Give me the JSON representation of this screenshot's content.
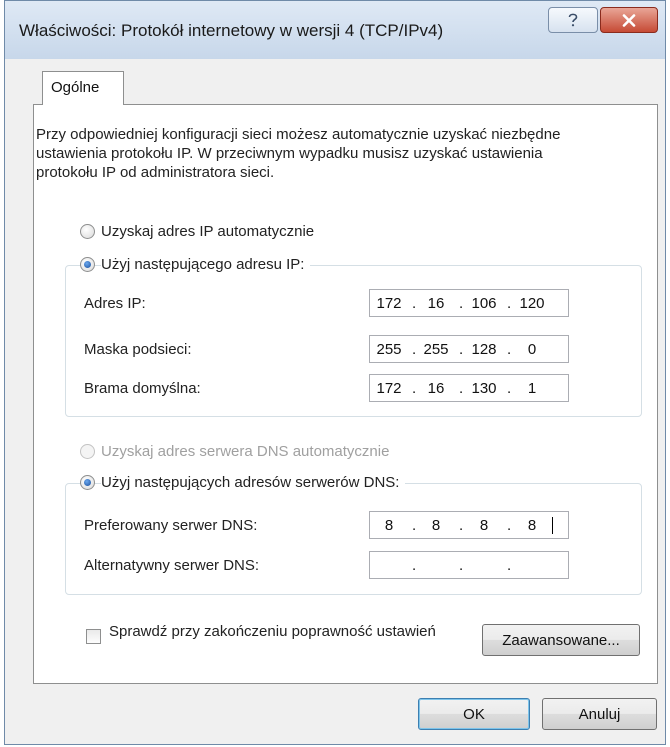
{
  "window": {
    "title": "Właściwości: Protokół internetowy w wersji 4 (TCP/IPv4)",
    "help_icon": "question-mark-icon",
    "close_icon": "close-x-icon"
  },
  "tabs": [
    {
      "label": "Ogólne"
    }
  ],
  "description": "Przy odpowiedniej konfiguracji sieci możesz automatycznie uzyskać niezbędne ustawienia protokołu IP. W przeciwnym wypadku musisz uzyskać ustawienia protokołu IP od administratora sieci.",
  "ip_section": {
    "auto": {
      "label": "Uzyskaj adres IP automatycznie",
      "selected": false
    },
    "manual": {
      "label": "Użyj następującego adresu IP:",
      "selected": true
    },
    "fields": [
      {
        "label": "Adres IP:",
        "octets": [
          "172",
          "16",
          "106",
          "120"
        ]
      },
      {
        "label": "Maska podsieci:",
        "octets": [
          "255",
          "255",
          "128",
          "0"
        ]
      },
      {
        "label": "Brama domyślna:",
        "octets": [
          "172",
          "16",
          "130",
          "1"
        ]
      }
    ]
  },
  "dns_section": {
    "auto": {
      "label": "Uzyskaj adres serwera DNS automatycznie",
      "selected": false,
      "enabled": false
    },
    "manual": {
      "label": "Użyj następujących adresów serwerów DNS:",
      "selected": true
    },
    "fields": [
      {
        "label": "Preferowany serwer DNS:",
        "octets": [
          "8",
          "8",
          "8",
          "8"
        ]
      },
      {
        "label": "Alternatywny serwer DNS:",
        "octets": [
          "",
          "",
          "",
          ""
        ]
      }
    ]
  },
  "validate_checkbox": {
    "label": "Sprawdź przy zakończeniu poprawność ustawień",
    "checked": false
  },
  "buttons": {
    "advanced": "Zaawansowane...",
    "ok": "OK",
    "cancel": "Anuluj"
  },
  "colors": {
    "close_button": "#c64a35",
    "radio_selected": "#1c4f9c",
    "ok_focus": "#3c7fb1"
  }
}
